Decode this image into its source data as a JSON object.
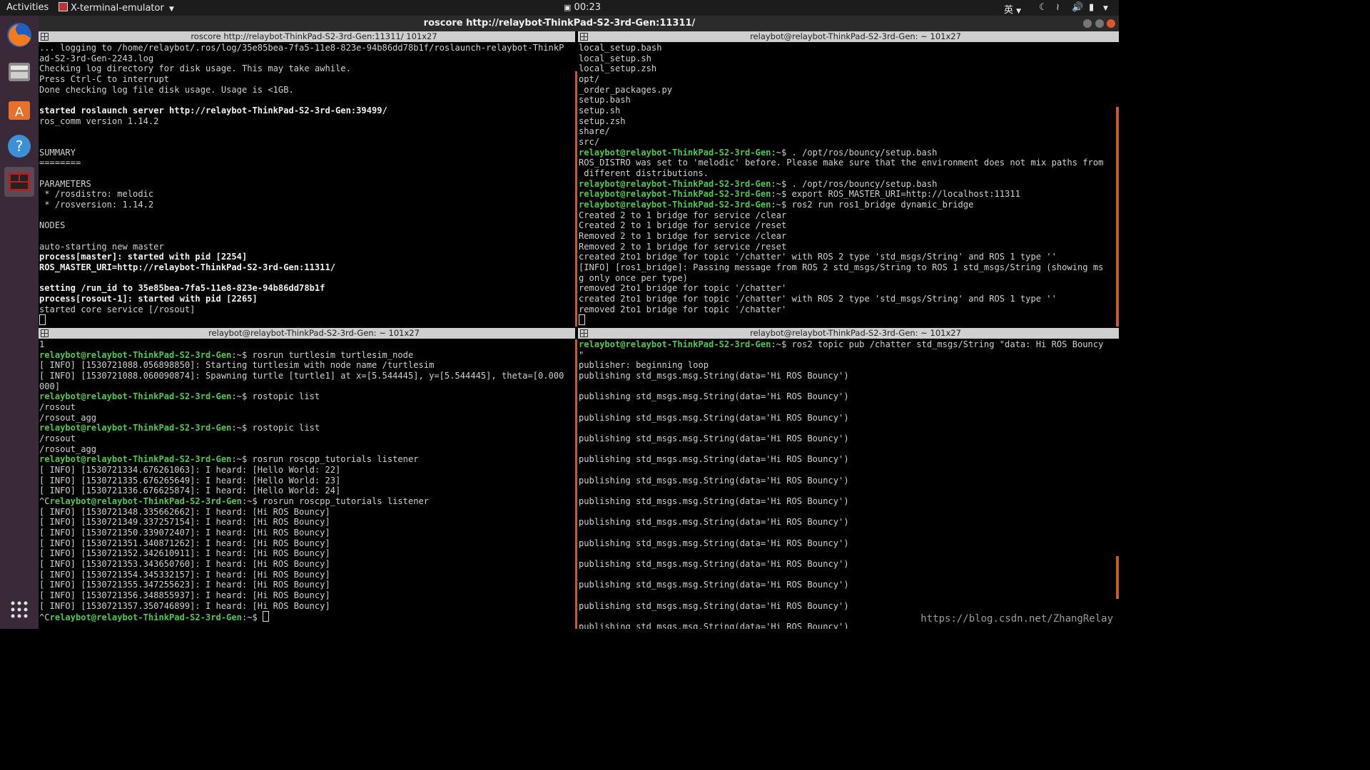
{
  "topbar": {
    "activities": "Activities",
    "app_name": "X-terminal-emulator",
    "clock": "00:23",
    "input_method": "英"
  },
  "window": {
    "title": "roscore http://relaybot-ThinkPad-S2-3rd-Gen:11311/"
  },
  "dock": {
    "items": [
      "firefox-icon",
      "files-icon",
      "software-center-icon",
      "help-icon",
      "terminal-icon",
      "show-applications-icon"
    ]
  },
  "panes": [
    {
      "title": "roscore http://relaybot-ThinkPad-S2-3rd-Gen:11311/ 101x27",
      "lines": [
        {
          "t": "... logging to /home/relaybot/.ros/log/35e85bea-7fa5-11e8-823e-94b86dd78b1f/roslaunch-relaybot-ThinkP"
        },
        {
          "t": "ad-S2-3rd-Gen-2243.log"
        },
        {
          "t": "Checking log directory for disk usage. This may take awhile."
        },
        {
          "t": "Press Ctrl-C to interrupt"
        },
        {
          "t": "Done checking log file disk usage. Usage is <1GB."
        },
        {
          "t": ""
        },
        {
          "t": "started roslaunch server http://relaybot-ThinkPad-S2-3rd-Gen:39499/",
          "b": true
        },
        {
          "t": "ros_comm version 1.14.2"
        },
        {
          "t": ""
        },
        {
          "t": ""
        },
        {
          "t": "SUMMARY"
        },
        {
          "t": "========"
        },
        {
          "t": ""
        },
        {
          "t": "PARAMETERS"
        },
        {
          "t": " * /rosdistro: melodic"
        },
        {
          "t": " * /rosversion: 1.14.2"
        },
        {
          "t": ""
        },
        {
          "t": "NODES"
        },
        {
          "t": ""
        },
        {
          "t": "auto-starting new master"
        },
        {
          "t": "process[master]: started with pid [2254]",
          "b": true
        },
        {
          "t": "ROS_MASTER_URI=http://relaybot-ThinkPad-S2-3rd-Gen:11311/",
          "b": true
        },
        {
          "t": ""
        },
        {
          "t": "setting /run_id to 35e85bea-7fa5-11e8-823e-94b86dd78b1f",
          "b": true
        },
        {
          "t": "process[rosout-1]: started with pid [2265]",
          "b": true
        },
        {
          "t": "started core service [/rosout]"
        },
        {
          "t": "",
          "cursor": true
        }
      ]
    },
    {
      "title": "relaybot@relaybot-ThinkPad-S2-3rd-Gen: ~ 101x27",
      "lines": [
        {
          "t": "local_setup.bash"
        },
        {
          "t": "local_setup.sh"
        },
        {
          "t": "local_setup.zsh"
        },
        {
          "t": "opt/"
        },
        {
          "t": "_order_packages.py"
        },
        {
          "t": "setup.bash"
        },
        {
          "t": "setup.sh"
        },
        {
          "t": "setup.zsh"
        },
        {
          "t": "share/"
        },
        {
          "t": "src/"
        },
        {
          "p": "relaybot@relaybot-ThinkPad-S2-3rd-Gen",
          "t": ":~$ . /opt/ros/bouncy/setup.bash"
        },
        {
          "t": "ROS_DISTRO was set to 'melodic' before. Please make sure that the environment does not mix paths from"
        },
        {
          "t": " different distributions."
        },
        {
          "p": "relaybot@relaybot-ThinkPad-S2-3rd-Gen",
          "t": ":~$ . /opt/ros/bouncy/setup.bash"
        },
        {
          "p": "relaybot@relaybot-ThinkPad-S2-3rd-Gen",
          "t": ":~$ export ROS_MASTER_URI=http://localhost:11311"
        },
        {
          "p": "relaybot@relaybot-ThinkPad-S2-3rd-Gen",
          "t": ":~$ ros2 run ros1_bridge dynamic_bridge"
        },
        {
          "t": "Created 2 to 1 bridge for service /clear"
        },
        {
          "t": "Created 2 to 1 bridge for service /reset"
        },
        {
          "t": "Removed 2 to 1 bridge for service /clear"
        },
        {
          "t": "Removed 2 to 1 bridge for service /reset"
        },
        {
          "t": "created 2to1 bridge for topic '/chatter' with ROS 2 type 'std_msgs/String' and ROS 1 type ''"
        },
        {
          "t": "[INFO] [ros1_bridge]: Passing message from ROS 2 std_msgs/String to ROS 1 std_msgs/String (showing ms"
        },
        {
          "t": "g only once per type)"
        },
        {
          "t": "removed 2to1 bridge for topic '/chatter'"
        },
        {
          "t": "created 2to1 bridge for topic '/chatter' with ROS 2 type 'std_msgs/String' and ROS 1 type ''"
        },
        {
          "t": "removed 2to1 bridge for topic '/chatter'"
        },
        {
          "t": "",
          "cursor": true
        }
      ]
    },
    {
      "title": "relaybot@relaybot-ThinkPad-S2-3rd-Gen: ~ 101x27",
      "lines": [
        {
          "t": "1"
        },
        {
          "p": "relaybot@relaybot-ThinkPad-S2-3rd-Gen",
          "t": ":~$ rosrun turtlesim turtlesim_node"
        },
        {
          "t": "[ INFO] [1530721088.056898850]: Starting turtlesim with node name /turtlesim"
        },
        {
          "t": "[ INFO] [1530721088.060090874]: Spawning turtle [turtle1] at x=[5.544445], y=[5.544445], theta=[0.000"
        },
        {
          "t": "000]"
        },
        {
          "p": "relaybot@relaybot-ThinkPad-S2-3rd-Gen",
          "t": ":~$ rostopic list"
        },
        {
          "t": "/rosout"
        },
        {
          "t": "/rosout_agg"
        },
        {
          "p": "relaybot@relaybot-ThinkPad-S2-3rd-Gen",
          "t": ":~$ rostopic list"
        },
        {
          "t": "/rosout"
        },
        {
          "t": "/rosout_agg"
        },
        {
          "p": "relaybot@relaybot-ThinkPad-S2-3rd-Gen",
          "t": ":~$ rosrun roscpp_tutorials listener"
        },
        {
          "t": "[ INFO] [1530721334.676261063]: I heard: [Hello World: 22]"
        },
        {
          "t": "[ INFO] [1530721335.676265649]: I heard: [Hello World: 23]"
        },
        {
          "t": "[ INFO] [1530721336.676625874]: I heard: [Hello World: 24]"
        },
        {
          "pre": "^C",
          "p": "relaybot@relaybot-ThinkPad-S2-3rd-Gen",
          "t": ":~$ rosrun roscpp_tutorials listener"
        },
        {
          "t": "[ INFO] [1530721348.335662662]: I heard: [Hi ROS Bouncy]"
        },
        {
          "t": "[ INFO] [1530721349.337257154]: I heard: [Hi ROS Bouncy]"
        },
        {
          "t": "[ INFO] [1530721350.339072407]: I heard: [Hi ROS Bouncy]"
        },
        {
          "t": "[ INFO] [1530721351.340871262]: I heard: [Hi ROS Bouncy]"
        },
        {
          "t": "[ INFO] [1530721352.342610911]: I heard: [Hi ROS Bouncy]"
        },
        {
          "t": "[ INFO] [1530721353.343650760]: I heard: [Hi ROS Bouncy]"
        },
        {
          "t": "[ INFO] [1530721354.345332157]: I heard: [Hi ROS Bouncy]"
        },
        {
          "t": "[ INFO] [1530721355.347255623]: I heard: [Hi ROS Bouncy]"
        },
        {
          "t": "[ INFO] [1530721356.348855937]: I heard: [Hi ROS Bouncy]"
        },
        {
          "t": "[ INFO] [1530721357.350746899]: I heard: [Hi ROS Bouncy]"
        },
        {
          "pre": "^C",
          "p": "relaybot@relaybot-ThinkPad-S2-3rd-Gen",
          "t": ":~$ ",
          "cursor": true
        }
      ]
    },
    {
      "title": "relaybot@relaybot-ThinkPad-S2-3rd-Gen: ~ 101x27",
      "lines": [
        {
          "p": "relaybot@relaybot-ThinkPad-S2-3rd-Gen",
          "t": ":~$ ros2 topic pub /chatter std_msgs/String \"data: Hi ROS Bouncy"
        },
        {
          "t": "\""
        },
        {
          "t": "publisher: beginning loop"
        },
        {
          "t": "publishing std_msgs.msg.String(data='Hi ROS Bouncy')"
        },
        {
          "t": ""
        },
        {
          "t": "publishing std_msgs.msg.String(data='Hi ROS Bouncy')"
        },
        {
          "t": ""
        },
        {
          "t": "publishing std_msgs.msg.String(data='Hi ROS Bouncy')"
        },
        {
          "t": ""
        },
        {
          "t": "publishing std_msgs.msg.String(data='Hi ROS Bouncy')"
        },
        {
          "t": ""
        },
        {
          "t": "publishing std_msgs.msg.String(data='Hi ROS Bouncy')"
        },
        {
          "t": ""
        },
        {
          "t": "publishing std_msgs.msg.String(data='Hi ROS Bouncy')"
        },
        {
          "t": ""
        },
        {
          "t": "publishing std_msgs.msg.String(data='Hi ROS Bouncy')"
        },
        {
          "t": ""
        },
        {
          "t": "publishing std_msgs.msg.String(data='Hi ROS Bouncy')"
        },
        {
          "t": ""
        },
        {
          "t": "publishing std_msgs.msg.String(data='Hi ROS Bouncy')"
        },
        {
          "t": ""
        },
        {
          "t": "publishing std_msgs.msg.String(data='Hi ROS Bouncy')"
        },
        {
          "t": ""
        },
        {
          "t": "publishing std_msgs.msg.String(data='Hi ROS Bouncy')"
        },
        {
          "t": ""
        },
        {
          "t": "publishing std_msgs.msg.String(data='Hi ROS Bouncy')"
        },
        {
          "t": ""
        },
        {
          "t": "publishing std_msgs.msg.String(data='Hi ROS Bouncy')"
        }
      ]
    }
  ],
  "watermark": "https://blog.csdn.net/ZhangRelay",
  "colors": {
    "prompt": "#4ec94e",
    "accent": "#c8572a",
    "panel": "#1c1c1c",
    "dock": "#3a2a38"
  }
}
